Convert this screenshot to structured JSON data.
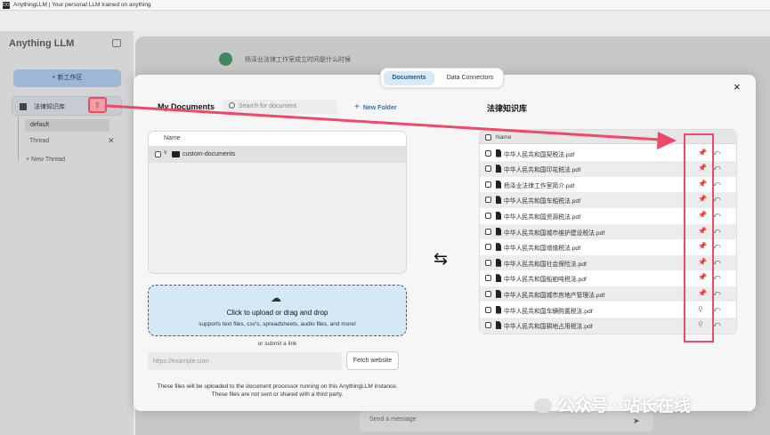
{
  "window": {
    "title": "AnythingLLM | Your personal LLM trained on anything",
    "icon_text": "DO"
  },
  "sidebar": {
    "logo": "Anything LLM",
    "new_workspace": "+ 新工作区",
    "workspace": "法律知识库",
    "upload_icon": "⇪",
    "thread_default": "default",
    "thread_item": "Thread",
    "new_thread": "+ New Thread"
  },
  "chat": {
    "message": "杨泽业法律工作室成立时间是什么时候",
    "send_placeholder": "Send a message"
  },
  "modal": {
    "tabs": [
      "Documents",
      "Data Connectors"
    ],
    "close": "×",
    "my_documents": "My Documents",
    "search_placeholder": "Search for document",
    "new_folder": "New Folder",
    "name_header": "Name",
    "folder": "custom-documents",
    "upload_title": "Click to upload or drag and drop",
    "upload_sub": "supports text files, csv's, spreadsheets, audio files, and more!",
    "or_link": "or submit a link",
    "url_placeholder": "https://example.com",
    "fetch": "Fetch website",
    "footnote_1": "These files will be uploaded to the document processor running on this AnythingLLM instance.",
    "footnote_2": "These files are not sent or shared with a third party.",
    "swap_icon": "⇆",
    "workspace_title": "法律知识库",
    "ws_name_header": "Name",
    "workspace_docs": [
      {
        "name": "中华人民共和国契税法.pdf",
        "pinned": true
      },
      {
        "name": "中华人民共和国印花税法.pdf",
        "pinned": true
      },
      {
        "name": "杨泽业法律工作室简介.pdf",
        "pinned": true
      },
      {
        "name": "中华人民共和国车船税法.pdf",
        "pinned": true
      },
      {
        "name": "中华人民共和国资源税法.pdf",
        "pinned": true
      },
      {
        "name": "中华人民共和国城市维护建设税法.pdf",
        "pinned": true
      },
      {
        "name": "中华人民共和国增值税法.pdf",
        "pinned": true
      },
      {
        "name": "中华人民共和国社会保险法.pdf",
        "pinned": true
      },
      {
        "name": "中华人民共和国船舶吨税法.pdf",
        "pinned": true
      },
      {
        "name": "中华人民共和国城市房地产管理法.pdf",
        "pinned": true
      },
      {
        "name": "中华人民共和国车辆购置税法.pdf",
        "pinned": false
      },
      {
        "name": "中华人民共和国耕地占用税法.pdf",
        "pinned": false
      }
    ]
  },
  "watermark": "公众号 · 站长在线"
}
